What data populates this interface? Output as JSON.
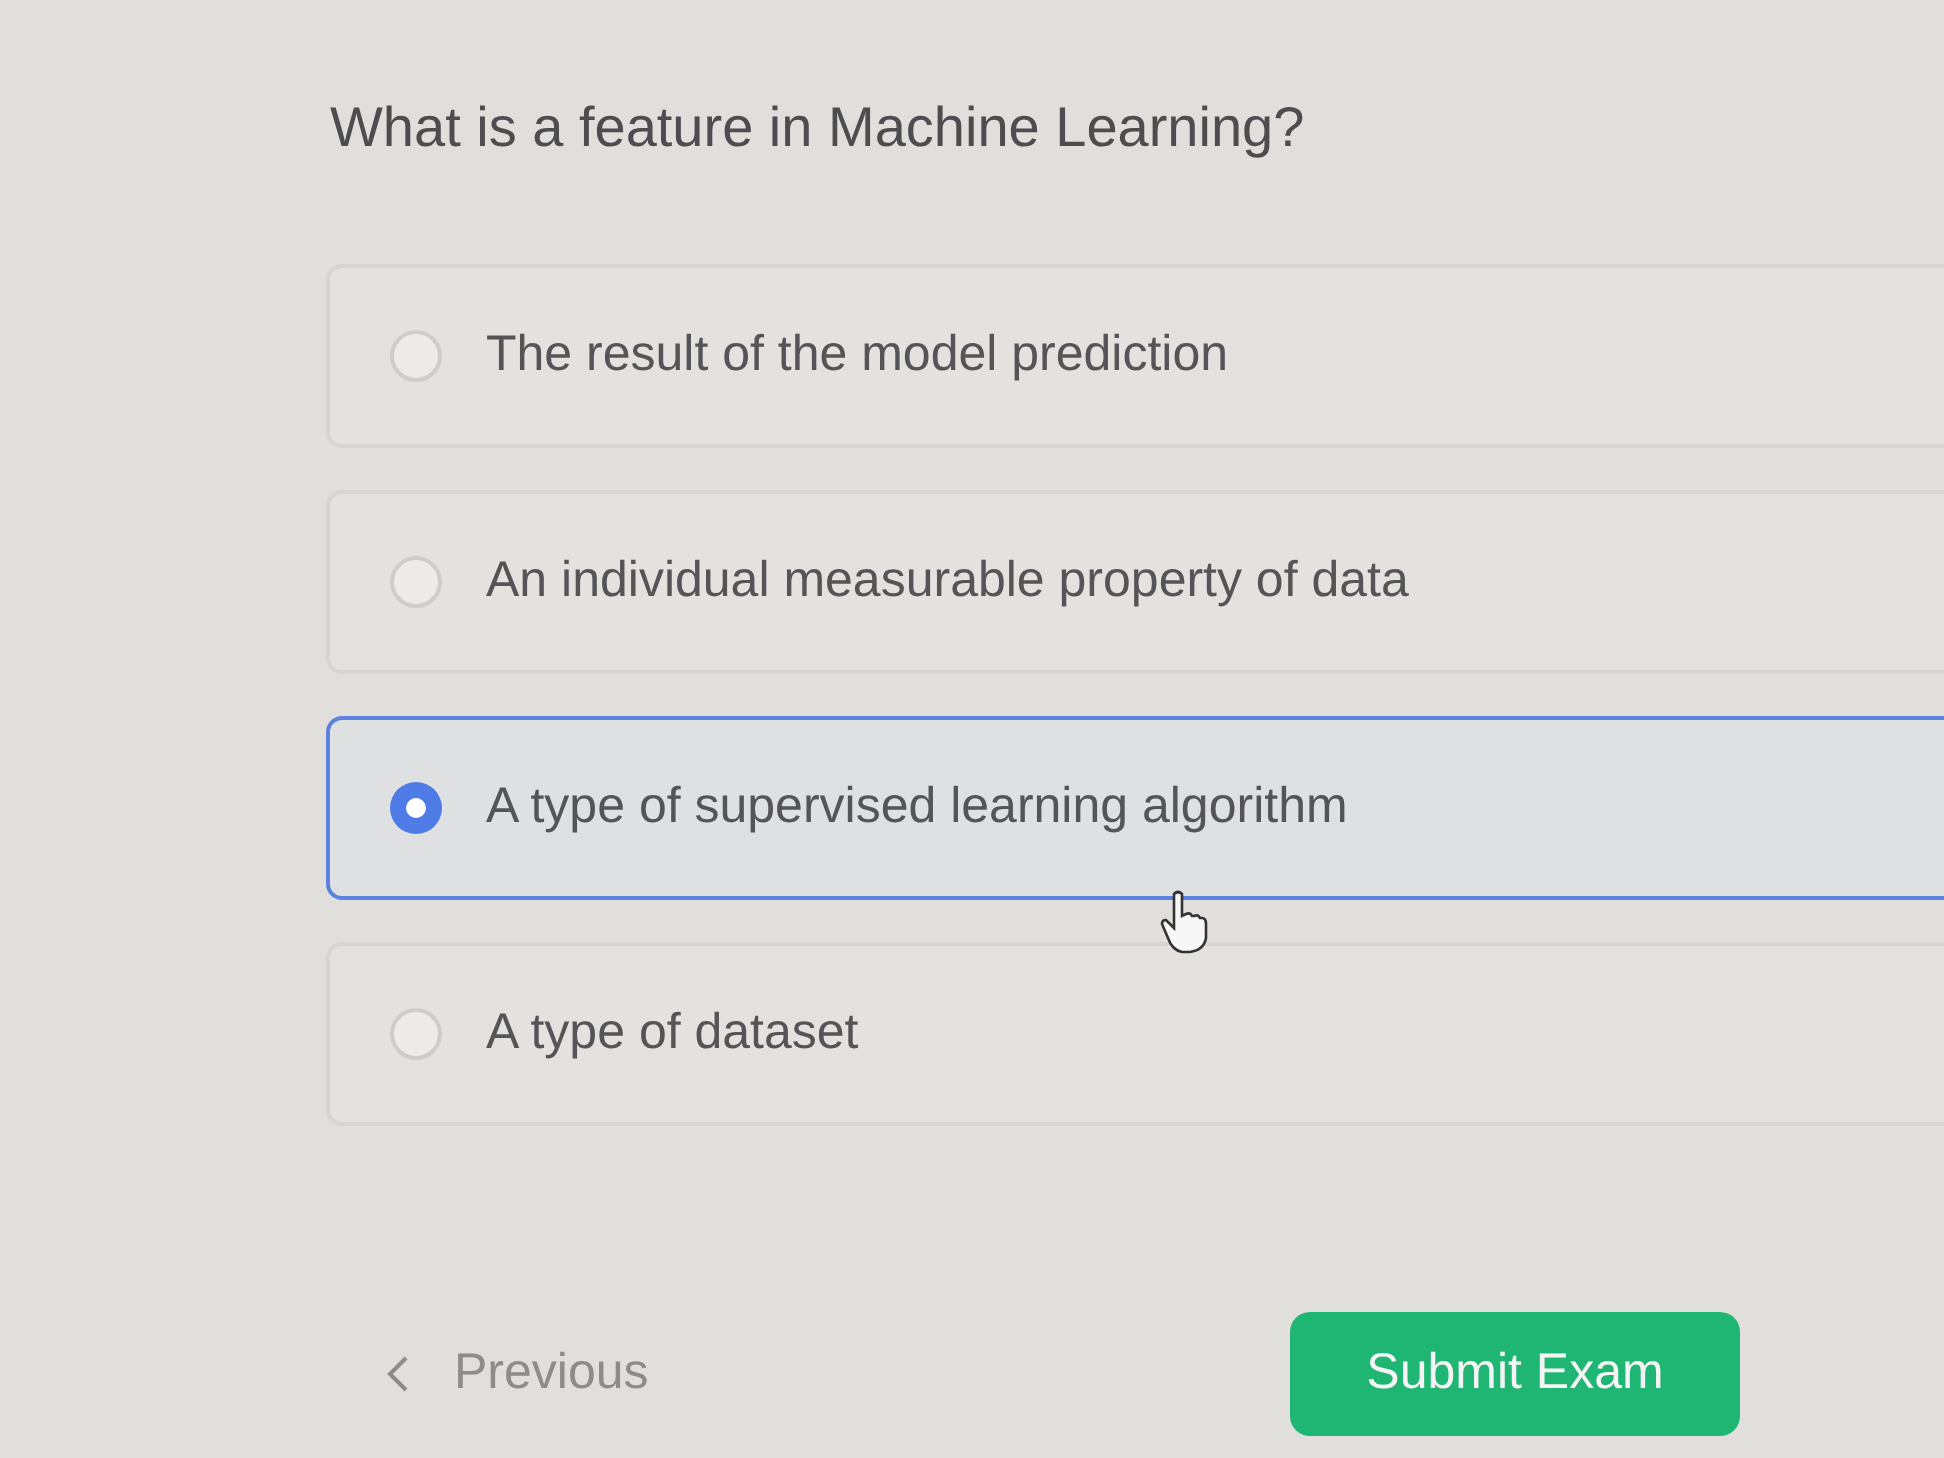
{
  "question": {
    "text": "What is a feature in Machine Learning?"
  },
  "options": [
    {
      "label": "The result of the model prediction",
      "selected": false
    },
    {
      "label": "An individual measurable property of data",
      "selected": false
    },
    {
      "label": "A type of supervised learning algorithm",
      "selected": true
    },
    {
      "label": "A type of dataset",
      "selected": false
    }
  ],
  "navigation": {
    "previous": {
      "label": "Previous",
      "disabled": true
    },
    "submit": {
      "label": "Submit Exam",
      "disabled": false
    }
  }
}
